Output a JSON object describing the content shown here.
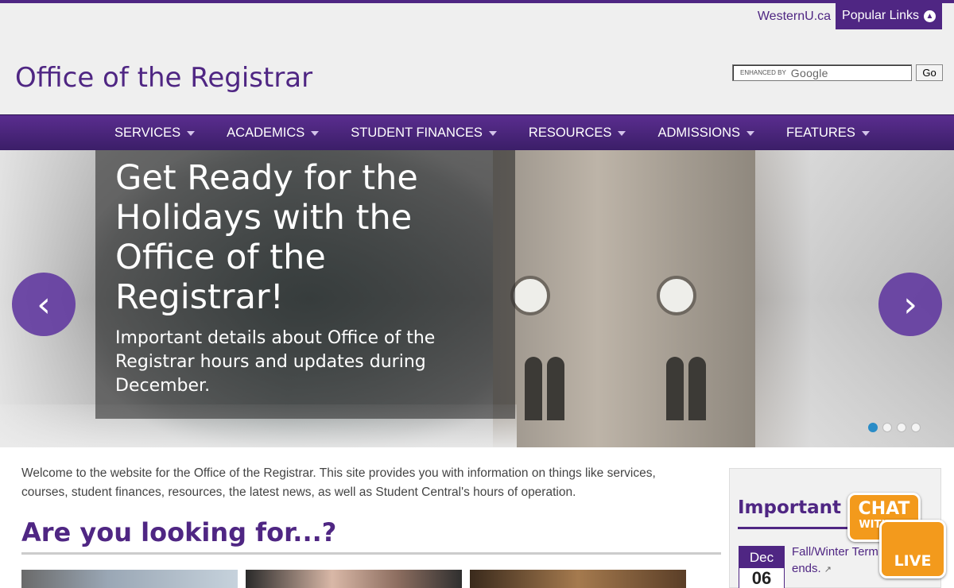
{
  "utility": {
    "westernu_link": "WesternU.ca",
    "popular_links": "Popular Links"
  },
  "site": {
    "title": "Office of the Registrar"
  },
  "search": {
    "enhanced_by": "ENHANCED BY",
    "brand": "Google",
    "go_label": "Go"
  },
  "nav": {
    "items": [
      {
        "label": "SERVICES"
      },
      {
        "label": "ACADEMICS"
      },
      {
        "label": "STUDENT FINANCES"
      },
      {
        "label": "RESOURCES"
      },
      {
        "label": "ADMISSIONS"
      },
      {
        "label": "FEATURES"
      }
    ]
  },
  "hero": {
    "headline": "Get Ready for the Holidays with the Office of the Registrar!",
    "subtext": "Important details about Office of the Registrar hours and updates during December.",
    "prev_glyph": "‹",
    "next_glyph": "›",
    "slide_count": 4,
    "active_slide": 1
  },
  "main": {
    "intro": "Welcome to the website for the Office of the Registrar. This site provides you with information on things like services, courses, student finances, resources, the latest news, as well as Student Central's hours of operation.",
    "looking_heading": "Are you looking for...?"
  },
  "sidebar": {
    "heading": "Important Dates",
    "event": {
      "month": "Dec",
      "day": "06",
      "text": "Fall/Winter Term ends."
    }
  },
  "chat": {
    "line1": "CHAT",
    "line2": "WITH US",
    "line3": "LIVE"
  },
  "colors": {
    "brand": "#4f2683",
    "accent_orange": "#f39a1c",
    "dot_active": "#2a8cc7"
  }
}
